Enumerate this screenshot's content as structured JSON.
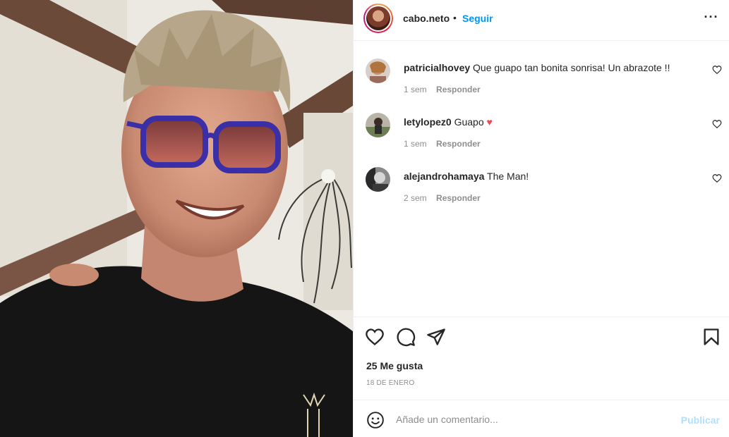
{
  "post": {
    "username": "cabo.neto",
    "separator": "•",
    "follow_label": "Seguir",
    "more_label": "···"
  },
  "comments": [
    {
      "user": "patricialhovey",
      "text": "Que guapo tan bonita sonrisa! Un abrazote !!",
      "time": "1 sem",
      "reply": "Responder",
      "emoji": ""
    },
    {
      "user": "letylopez0",
      "text": "Guapo",
      "time": "1 sem",
      "reply": "Responder",
      "emoji": "♥"
    },
    {
      "user": "alejandrohamaya",
      "text": "The Man!",
      "time": "2 sem",
      "reply": "Responder",
      "emoji": ""
    }
  ],
  "actions": {
    "icons": [
      "heart-icon",
      "comment-icon",
      "share-icon",
      "bookmark-icon"
    ],
    "likes": "25 Me gusta",
    "date": "18 DE ENERO"
  },
  "add_comment": {
    "placeholder": "Añade un comentario...",
    "publish_label": "Publicar"
  },
  "colors": {
    "accent": "#0095f6",
    "publish_disabled": "#b2dffc",
    "muted": "#8e8e8e",
    "heart_red": "#ed4956"
  }
}
